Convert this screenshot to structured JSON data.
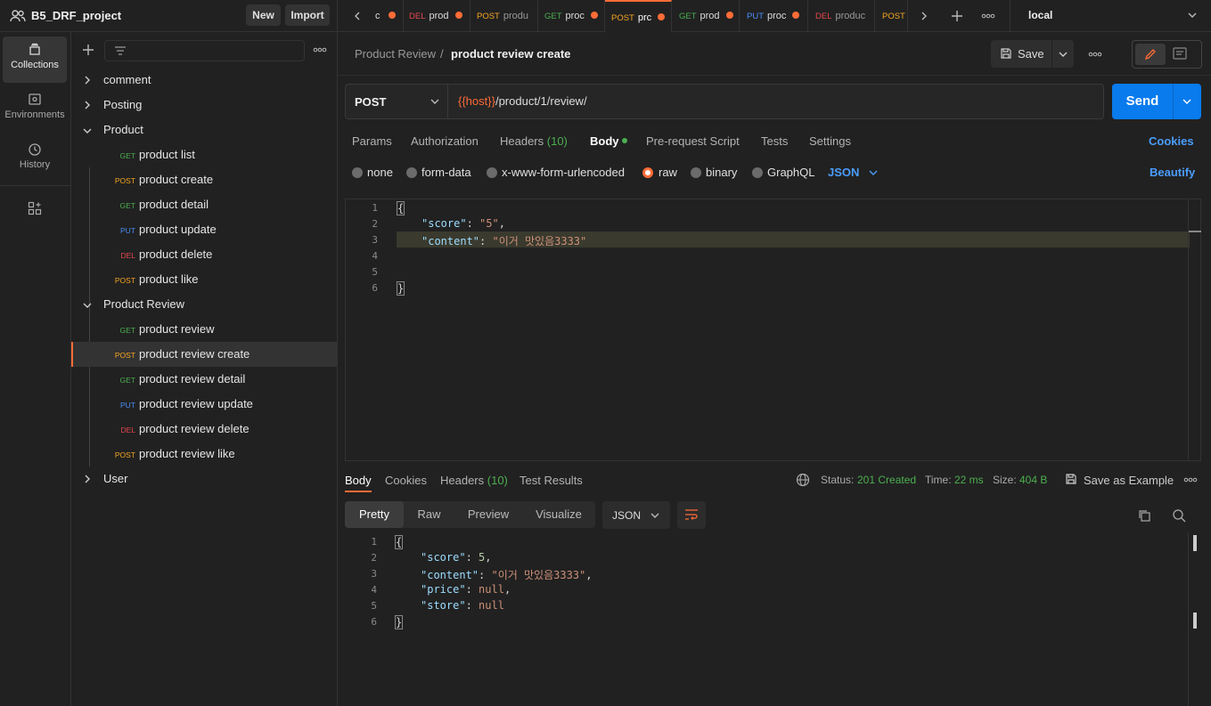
{
  "workspace": {
    "name": "B5_DRF_project",
    "new_label": "New",
    "import_label": "Import"
  },
  "rail": {
    "items": [
      {
        "label": "Collections",
        "icon": "collections-icon"
      },
      {
        "label": "Environments",
        "icon": "environments-icon"
      },
      {
        "label": "History",
        "icon": "history-icon"
      }
    ]
  },
  "tree": {
    "folders": [
      "comment",
      "Posting",
      "Product",
      "Product Review",
      "User"
    ],
    "product_requests": [
      {
        "method": "GET",
        "name": "product list"
      },
      {
        "method": "POST",
        "name": "product create"
      },
      {
        "method": "GET",
        "name": "product detail"
      },
      {
        "method": "PUT",
        "name": "product update"
      },
      {
        "method": "DEL",
        "name": "product delete"
      },
      {
        "method": "POST",
        "name": "product like"
      }
    ],
    "review_requests": [
      {
        "method": "GET",
        "name": "product review"
      },
      {
        "method": "POST",
        "name": "product review create"
      },
      {
        "method": "GET",
        "name": "product review detail"
      },
      {
        "method": "PUT",
        "name": "product review update"
      },
      {
        "method": "DEL",
        "name": "product review delete"
      },
      {
        "method": "POST",
        "name": "product review like"
      }
    ]
  },
  "tabs": [
    {
      "method": "",
      "title": "c"
    },
    {
      "method": "DEL",
      "title": "prod"
    },
    {
      "method": "POST",
      "title": "produ"
    },
    {
      "method": "GET",
      "title": "proc"
    },
    {
      "method": "POST",
      "title": "prc"
    },
    {
      "method": "GET",
      "title": "prod"
    },
    {
      "method": "PUT",
      "title": "proc"
    },
    {
      "method": "DEL",
      "title": "produc"
    },
    {
      "method": "POST",
      "title": ""
    }
  ],
  "environment": "local",
  "breadcrumb": {
    "parent": "Product Review",
    "sep": "/",
    "current": "product review create"
  },
  "save_label": "Save",
  "request": {
    "method": "POST",
    "url_var": "{{host}}",
    "url_path": "/product/1/review/",
    "send_label": "Send"
  },
  "req_tabs": {
    "params": "Params",
    "auth": "Authorization",
    "headers": "Headers",
    "headers_count": "(10)",
    "body": "Body",
    "prereq": "Pre-request Script",
    "tests": "Tests",
    "settings": "Settings",
    "cookies": "Cookies"
  },
  "body_types": {
    "none": "none",
    "form_data": "form-data",
    "urlencoded": "x-www-form-urlencoded",
    "raw": "raw",
    "binary": "binary",
    "graphql": "GraphQL",
    "lang": "JSON",
    "beautify": "Beautify"
  },
  "req_body": {
    "l1": "{",
    "score_key": "\"score\"",
    "score_val": "\"5\"",
    "content_key": "\"content\"",
    "content_val": "\"이거 맛있음3333\"",
    "l6": "}",
    "line_numbers": [
      "1",
      "2",
      "3",
      "4",
      "5",
      "6"
    ]
  },
  "resp_tabs": {
    "body": "Body",
    "cookies": "Cookies",
    "headers": "Headers",
    "headers_count": "(10)",
    "tests": "Test Results"
  },
  "status": {
    "status_label": "Status:",
    "status": "201 Created",
    "time_label": "Time:",
    "time": "22 ms",
    "size_label": "Size:",
    "size": "404 B",
    "save_example": "Save as Example"
  },
  "resp_view": {
    "pretty": "Pretty",
    "raw": "Raw",
    "preview": "Preview",
    "visualize": "Visualize",
    "format": "JSON"
  },
  "resp_body": {
    "l1": "{",
    "score_key": "\"score\"",
    "score_val": "5",
    "content_key": "\"content\"",
    "content_val": "\"이거 맛있음3333\"",
    "price_key": "\"price\"",
    "price_val": "null",
    "store_key": "\"store\"",
    "store_val": "null",
    "l6": "}",
    "line_numbers": [
      "1",
      "2",
      "3",
      "4",
      "5",
      "6"
    ]
  }
}
